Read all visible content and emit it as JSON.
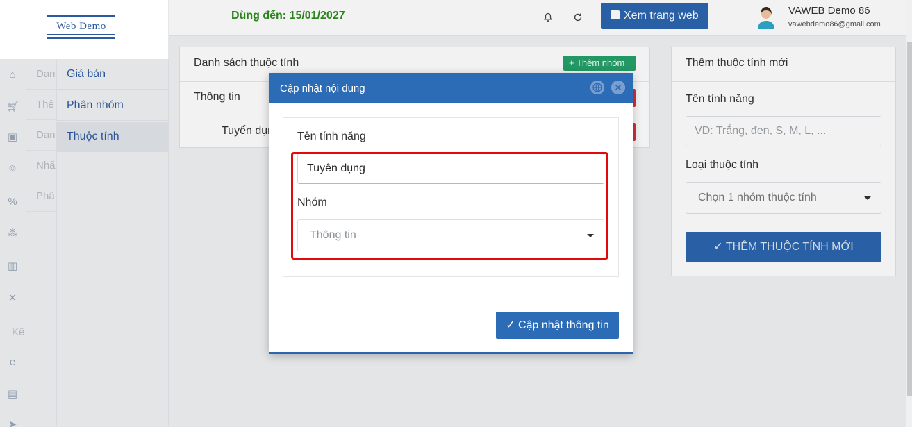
{
  "header": {
    "logo_text": "Web Demo",
    "expiry": "Dùng đến: 15/01/2027",
    "view_site_label": "Xem trang web",
    "user_name": "VAWEB Demo 86",
    "user_email": "vawebdemo86@gmail.com"
  },
  "sidebar": {
    "labels": [
      "Dan",
      "Thê",
      "Dan",
      "Nhã",
      "Phâ"
    ],
    "extra_label": "Kê",
    "submenu": [
      {
        "label": "Giá bán"
      },
      {
        "label": "Phân nhóm"
      },
      {
        "label": "Thuộc tính"
      }
    ]
  },
  "list_panel": {
    "title": "Danh sách thuộc tính",
    "add_group_label": "+ Thêm nhóm",
    "group_row": "Thông tin",
    "item_row": "Tuyển dụng"
  },
  "add_panel": {
    "title": "Thêm thuộc tính mới",
    "name_label": "Tên tính năng",
    "name_placeholder": "VD: Trắng, đen, S, M, L, ...",
    "type_label": "Loại thuộc tính",
    "type_placeholder": "Chọn 1 nhóm thuộc tính",
    "submit_label": "✓ THÊM THUỘC TÍNH MỚI"
  },
  "modal": {
    "title": "Cập nhật nội dung",
    "name_label": "Tên tính năng",
    "name_value": "Tuyên dụng",
    "group_label": "Nhóm",
    "group_value": "Thông tin",
    "submit_label": "✓ Cập nhật thông tin"
  },
  "colors": {
    "primary": "#2c65ad",
    "success": "#25a06a",
    "danger": "#d9343c",
    "expiry_green": "#2e8b1e",
    "highlight_red": "#e00a0a"
  }
}
